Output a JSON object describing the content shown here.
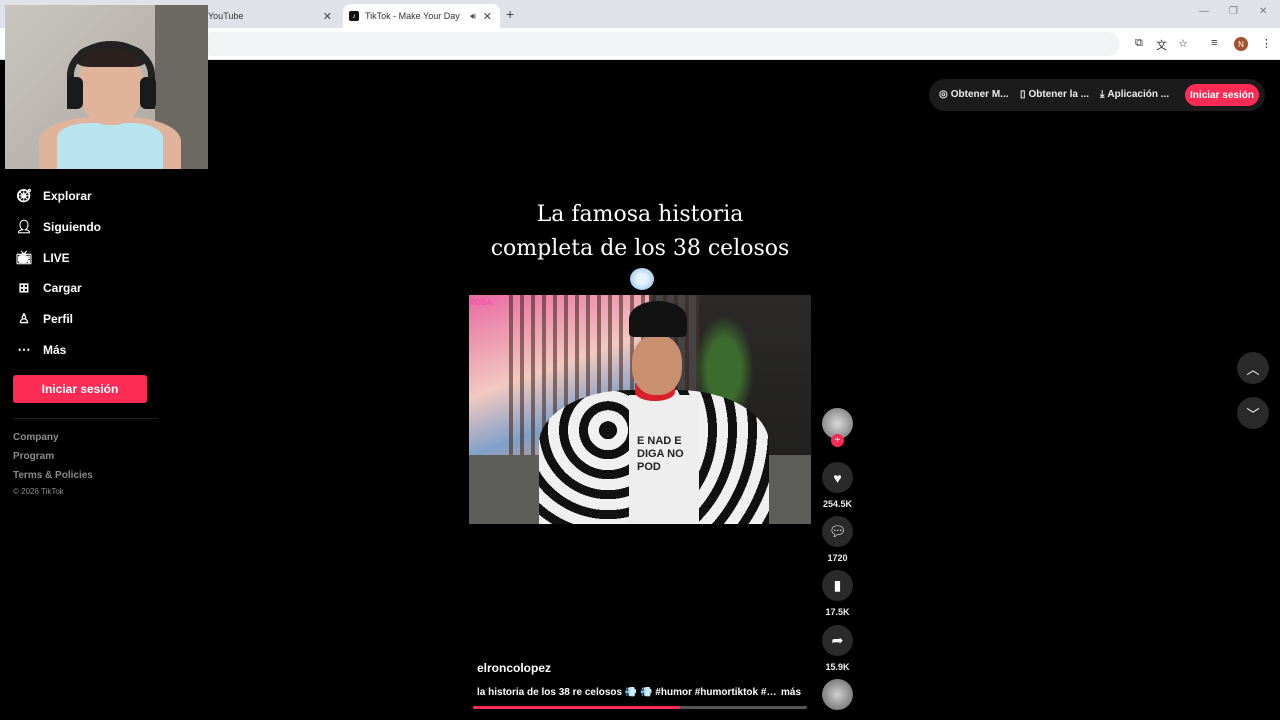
{
  "browser": {
    "tabs": [
      {
        "title": "YouTube",
        "active": false
      },
      {
        "title": "TikTok - Make Your Day",
        "active": true,
        "audio": true
      }
    ],
    "profile_initial": "N"
  },
  "sidebar": {
    "items": [
      {
        "label": "Explorar",
        "icon": "compass-icon"
      },
      {
        "label": "Siguiendo",
        "icon": "user-follow-icon"
      },
      {
        "label": "LIVE",
        "icon": "live-tv-icon"
      },
      {
        "label": "Cargar",
        "icon": "upload-plus-icon"
      },
      {
        "label": "Perfil",
        "icon": "person-icon"
      },
      {
        "label": "Más",
        "icon": "more-dots-icon"
      }
    ],
    "login_label": "Iniciar sesión",
    "footer": [
      "Company",
      "Program",
      "Terms & Policies"
    ],
    "copyright": "© 2026 TikTok"
  },
  "topbar": {
    "items": [
      {
        "label": "Obtener M...",
        "icon": "coin-icon"
      },
      {
        "label": "Obtener la ...",
        "icon": "phone-icon"
      },
      {
        "label": "Aplicación ...",
        "icon": "download-icon"
      }
    ],
    "login_label": "Iniciar sesión"
  },
  "video": {
    "overlay_title_line1": "La famosa historia",
    "overlay_title_line2": "completa de los 38 celosos",
    "channel_watermark": "ROSA",
    "shirt_text": "E NAD E DIGA NO POD",
    "progress": 0.62
  },
  "actions": {
    "likes": "254.5K",
    "comments": "1720",
    "saves": "17.5K",
    "shares": "15.9K"
  },
  "post": {
    "author": "elroncolopez",
    "description": "la historia de los 38 re celosos 💨 💨 #humor #humortiktok #parati...",
    "more_label": "más"
  },
  "colors": {
    "accent": "#fe2c55",
    "background": "#000000"
  }
}
